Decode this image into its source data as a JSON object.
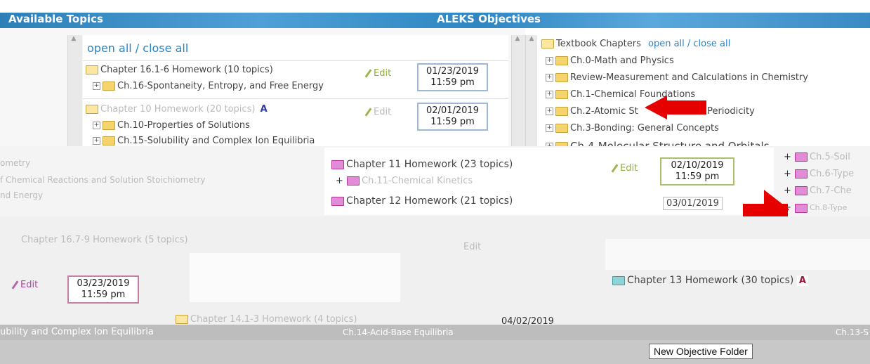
{
  "header": {
    "available_topics": "Available Topics",
    "aleks_objectives": "ALEKS Objectives"
  },
  "left_tree": {
    "open_close": "open all / close all",
    "folders": [
      {
        "label": "Chapter 16.1-6 Homework (10 topics)",
        "edit": "Edit",
        "date": "01/23/2019",
        "time": "11:59 pm",
        "child": "Ch.16-Spontaneity, Entropy, and Free Energy"
      },
      {
        "label": "Chapter 10 Homework (20 topics)",
        "badge": "A",
        "edit": "Edit",
        "date": "02/01/2019",
        "time": "11:59 pm",
        "child": "Ch.10-Properties of Solutions",
        "child2": "Ch.15-Solubility and Complex Ion Equilibria"
      }
    ]
  },
  "right_tree": {
    "title": "Textbook Chapters",
    "open_close": "open all / close all",
    "chapters": [
      "Ch.0-Math and Physics",
      "Review-Measurement and Calculations in Chemistry",
      "Ch.1-Chemical Foundations",
      "Ch.2-Atomic St",
      "d Periodicity",
      "Ch.3-Bonding: General Concepts",
      "Ch.4-Molecular Structure and Orbitals"
    ]
  },
  "middle": {
    "left_fragments": [
      "ometry",
      "f Chemical Reactions and Solution Stoichiometry",
      "nd Energy"
    ],
    "ch11": {
      "label": "Chapter 11 Homework (23 topics)",
      "child": "Ch.11-Chemical Kinetics",
      "edit": "Edit",
      "date": "02/10/2019",
      "time": "11:59 pm"
    },
    "ch12": {
      "label": "Chapter 12 Homework (21 topics)",
      "date": "03/01/2019"
    },
    "right_fragments": [
      "Ch.5-Soil",
      "Ch.6-Type",
      "Ch.7-Che",
      "Ch.8-Type"
    ]
  },
  "lower": {
    "ch16b": {
      "label": "Chapter 16.7-9 Homework (5 topics)",
      "edit": "Edit"
    },
    "edit_pink": "Edit",
    "date_pink": "03/23/2019",
    "time_pink": "11:59 pm",
    "ch13": {
      "label": "Chapter 13 Homework (30 topics)",
      "badge": "A"
    },
    "ch14": {
      "label": "Chapter 14.1-3 Homework (4 topics)",
      "date": "04/02/2019"
    },
    "bottom_left": "ubility and Complex Ion Equilibria",
    "bottom_mid": "Ch.14-Acid-Base Equilibria",
    "bottom_right": "Ch.13-S",
    "new_folder": "New Objective Folder"
  }
}
